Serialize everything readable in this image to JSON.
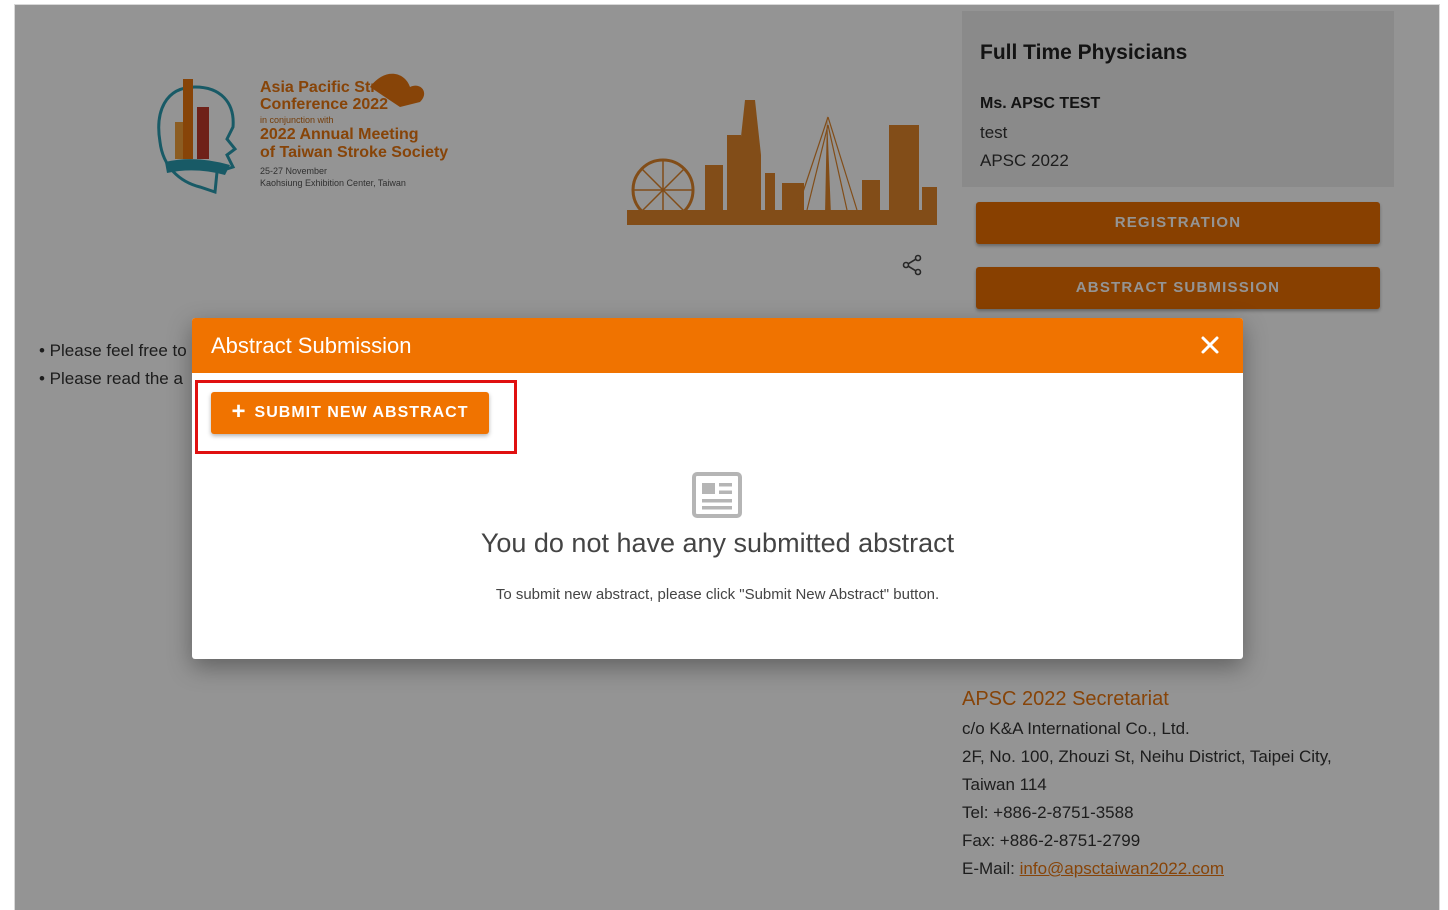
{
  "logo": {
    "line1": "Asia Pacific Stroke",
    "line2": "Conference 2022",
    "line3": "in conjunction with",
    "line4": "2022 Annual Meeting",
    "line5": "of Taiwan Stroke Society",
    "line6": "25-27 November",
    "line7": "Kaohsiung Exhibition Center, Taiwan"
  },
  "user_card": {
    "title": "Full Time Physicians",
    "name": "Ms. APSC TEST",
    "line2": "test",
    "line3": "APSC 2022"
  },
  "side_buttons": {
    "registration": "REGISTRATION",
    "abstract": "ABSTRACT SUBMISSION"
  },
  "bullets": {
    "b1": "• Please feel free to",
    "b2": "• Please read the a"
  },
  "secretariat": {
    "heading": "APSC 2022 Secretariat",
    "line1": "c/o K&A International Co., Ltd.",
    "line2": "2F, No. 100, Zhouzi St, Neihu District, Taipei City,",
    "line3": "Taiwan 114",
    "tel": "Tel: +886-2-8751-3588",
    "fax": "Fax: +886-2-8751-2799",
    "email_label": "E-Mail: ",
    "email": "info@apsctaiwan2022.com"
  },
  "modal": {
    "title": "Abstract Submission",
    "submit_label": "SUBMIT NEW ABSTRACT",
    "empty_title": "You do not have any submitted abstract",
    "empty_sub": "To submit new abstract, please click \"Submit New Abstract\" button."
  },
  "colors": {
    "accent": "#f07300",
    "highlight": "#e01010"
  }
}
